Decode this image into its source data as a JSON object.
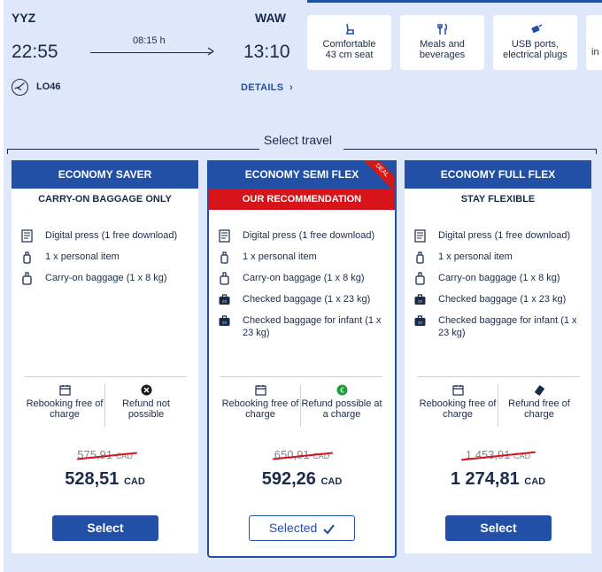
{
  "flight": {
    "origin": "YYZ",
    "destination": "WAW",
    "departure_time": "22:55",
    "arrival_time": "13:10",
    "duration": "08:15 h",
    "flight_number": "LO46",
    "details_label": "DETAILS",
    "airline_icon": "lot-crane-logo-icon",
    "colors": {
      "accent": "#2250a7",
      "text": "#1a2b4a",
      "background": "#dfe7fb"
    }
  },
  "amenities": [
    {
      "icon": "seat-icon",
      "label_line1": "Comfortable",
      "label_line2": "43 cm seat"
    },
    {
      "icon": "meals-icon",
      "label_line1": "Meals and",
      "label_line2": "beverages"
    },
    {
      "icon": "usb-plug-icon",
      "label_line1": "USB ports,",
      "label_line2": "electrical plugs"
    },
    {
      "icon": "info-icon",
      "label_line1": "in",
      "label_line2": ""
    }
  ],
  "select_travel": {
    "title": "Select travel"
  },
  "fares": [
    {
      "name": "ECONOMY SAVER",
      "subtitle": "CARRY-ON BAGGAGE ONLY",
      "features": [
        {
          "icon": "digital-press-icon",
          "text": "Digital press (1 free download)"
        },
        {
          "icon": "personal-item-icon",
          "text": "1 x personal item"
        },
        {
          "icon": "carry-on-bag-icon",
          "text": "Carry-on baggage  (1 x 8 kg)"
        }
      ],
      "rebooking": "Rebooking free of charge",
      "refund": "Refund not possible",
      "refund_icon": "not-possible-icon",
      "old_price": "575,91",
      "price": "528,51",
      "currency": "CAD",
      "button_label": "Select"
    },
    {
      "name": "ECONOMY SEMI FLEX",
      "ribbon": "DEAL",
      "subtitle": "OUR RECOMMENDATION",
      "features": [
        {
          "icon": "digital-press-icon",
          "text": "Digital press (1 free download)"
        },
        {
          "icon": "personal-item-icon",
          "text": "1 x personal item"
        },
        {
          "icon": "carry-on-bag-icon",
          "text": "Carry-on baggage  (1 x 8 kg)"
        },
        {
          "icon": "checked-bag-icon",
          "text": "Checked baggage (1 x 23 kg)"
        },
        {
          "icon": "checked-bag-icon",
          "text": "Checked baggage for infant (1 x 23 kg)"
        }
      ],
      "rebooking": "Rebooking free of charge",
      "refund": "Refund possible at a charge",
      "refund_icon": "euro-charge-icon",
      "old_price": "650,91",
      "price": "592,26",
      "currency": "CAD",
      "button_label": "Selected"
    },
    {
      "name": "ECONOMY FULL FLEX",
      "subtitle": "STAY FLEXIBLE",
      "features": [
        {
          "icon": "digital-press-icon",
          "text": "Digital press (1 free download)"
        },
        {
          "icon": "personal-item-icon",
          "text": "1 x personal item"
        },
        {
          "icon": "carry-on-bag-icon",
          "text": "Carry-on baggage  (1 x 8 kg)"
        },
        {
          "icon": "checked-bag-icon",
          "text": "Checked baggage (1 x 23 kg)"
        },
        {
          "icon": "checked-bag-icon",
          "text": "Checked baggage for infant (1 x 23 kg)"
        }
      ],
      "rebooking": "Rebooking free of charge",
      "refund": "Refund free of charge",
      "refund_icon": "refund-ticket-icon",
      "old_price": "1 453,91",
      "price": "1 274,81",
      "currency": "CAD",
      "button_label": "Select"
    }
  ]
}
